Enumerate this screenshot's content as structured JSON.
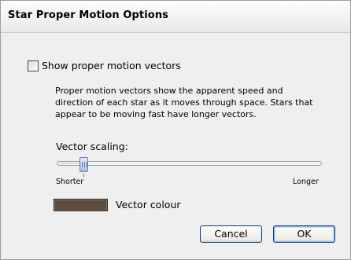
{
  "dialog": {
    "title": "Star Proper Motion Options"
  },
  "show_vectors": {
    "label": "Show proper motion vectors",
    "checked": false
  },
  "description": {
    "lines": [
      "Proper motion vectors show the apparent speed and",
      "direction of each star as it moves through space. Stars that",
      "appear to be moving fast have longer vectors."
    ]
  },
  "vector_scaling": {
    "label": "Vector scaling:",
    "min_label": "Shorter",
    "max_label": "Longer",
    "value_fraction": 0.09
  },
  "vector_colour": {
    "label": "Vector colour",
    "color": "#5c4c3e"
  },
  "buttons": {
    "cancel": "Cancel",
    "ok": "OK"
  },
  "colors": {
    "dialog_background": "#efefef",
    "button_border": "#003c74",
    "checkbox_border": "#1c5180"
  }
}
